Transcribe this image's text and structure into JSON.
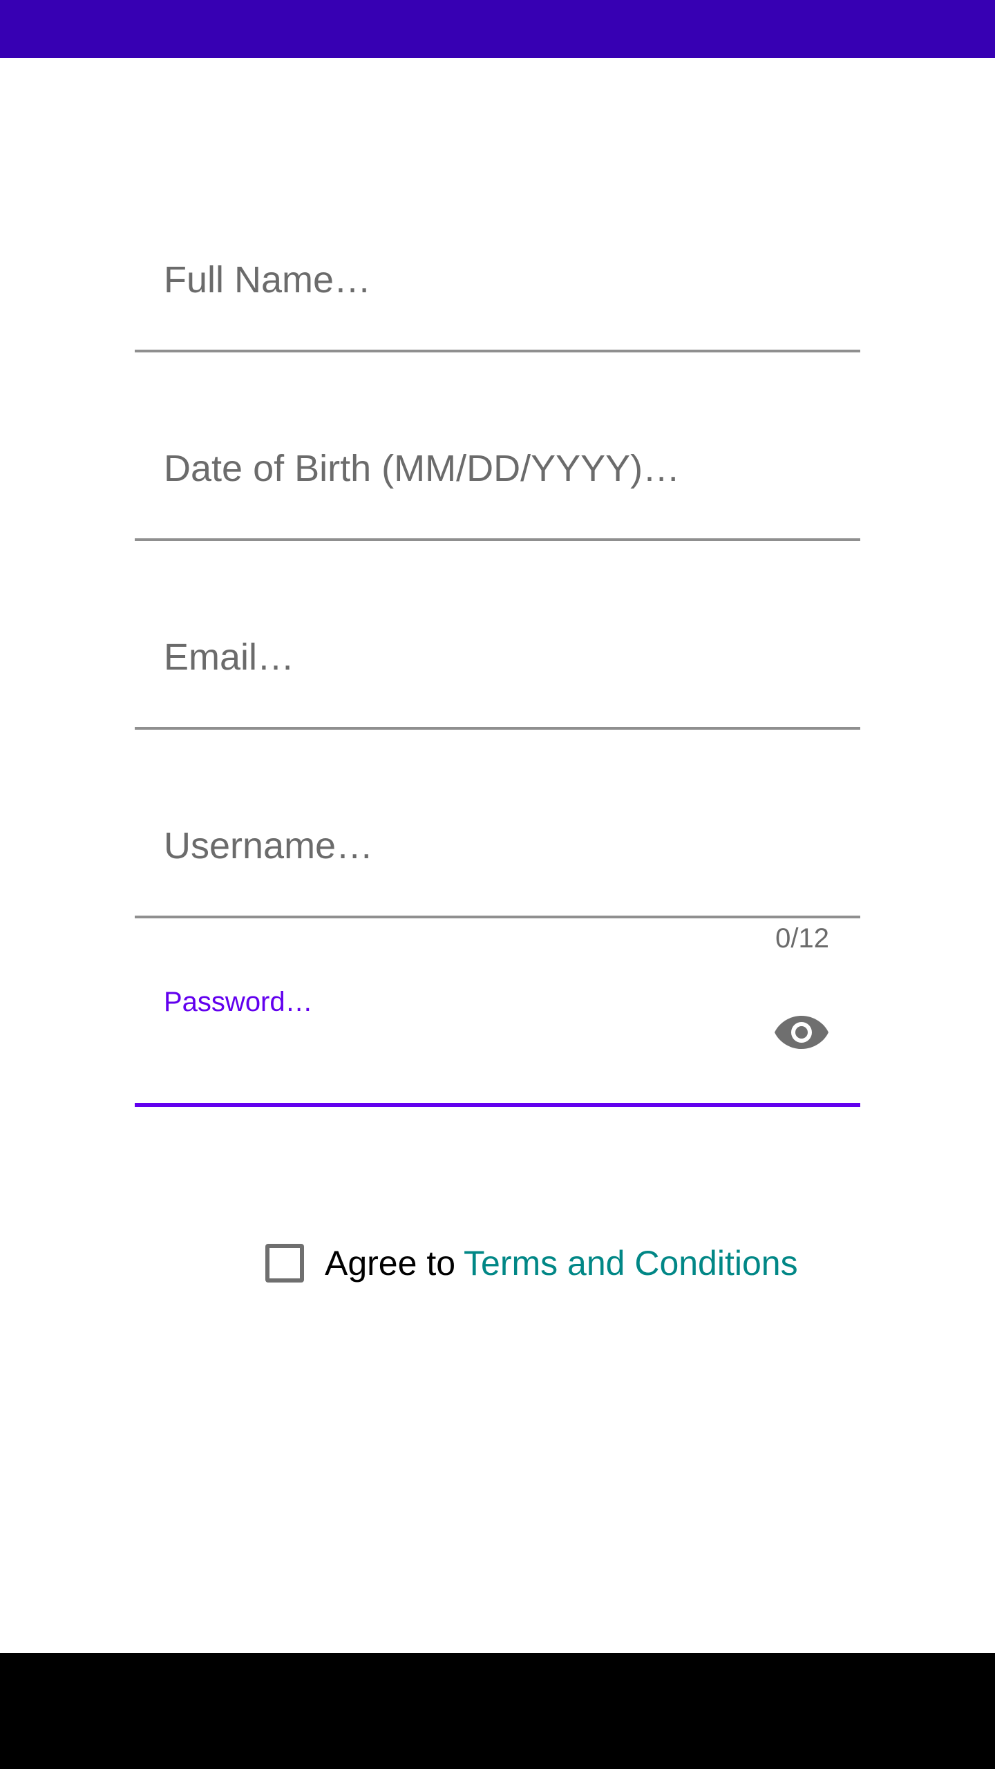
{
  "colors": {
    "status_bar": "#3700B3",
    "accent": "#6200EE",
    "link": "#018786",
    "hint": "#6b6b6b",
    "nav_bar": "#000000"
  },
  "form": {
    "full_name": {
      "placeholder": "Full Name…"
    },
    "date_of_birth": {
      "placeholder": "Date of Birth (MM/DD/YYYY)…"
    },
    "email": {
      "placeholder": "Email…"
    },
    "username": {
      "placeholder": "Username…",
      "counter": "0/12"
    },
    "password": {
      "label": "Password…",
      "toggle_icon": "eye-icon"
    }
  },
  "agreement": {
    "text": "Agree to",
    "link": "Terms and Conditions",
    "checked": false
  }
}
